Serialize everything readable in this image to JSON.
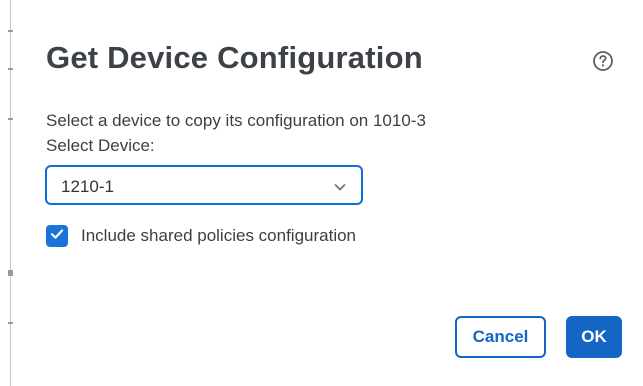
{
  "dialog": {
    "title": "Get Device Configuration",
    "help_icon": "question-circle-icon",
    "description": "Select a device to copy its configuration on 1010-3",
    "select_label": "Select Device:",
    "select": {
      "value": "1210-1",
      "icon": "chevron-down-icon"
    },
    "checkbox": {
      "label": "Include shared policies configuration",
      "checked": true,
      "icon": "checkmark-icon"
    },
    "buttons": {
      "cancel": "Cancel",
      "ok": "OK"
    }
  },
  "colors": {
    "primary": "#1466c4",
    "select_border": "#0d6fd6",
    "checkbox_fill": "#1a73d9",
    "text": "#3b3f44",
    "title": "#3d4248"
  }
}
